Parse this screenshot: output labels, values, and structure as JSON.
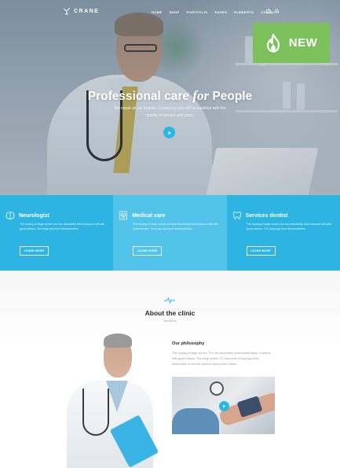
{
  "brand": {
    "name": "CRANE"
  },
  "nav": {
    "items": [
      "HOME",
      "SHOP",
      "PORTFOLIO",
      "PAGES",
      "ELEMENTS",
      "CONTACT"
    ],
    "icons": [
      "cart-icon",
      "search-icon"
    ]
  },
  "badge": {
    "label": "NEW",
    "icon": "flame-icon",
    "color": "#7cc15b"
  },
  "hero": {
    "title_pre": "Professional care ",
    "title_em": "for",
    "title_post": " People",
    "subtitle": "We repair all car brands. Contact us you will be satisfied with the quality of service and price.",
    "accent": "#29b6e8"
  },
  "services": [
    {
      "title": "Neurologist",
      "icon": "brain-icon",
      "text": "The buying of large screen tvs has absolutely that everyone will with good reason. The long way from thewonderfuls",
      "button": "LEARN MORE"
    },
    {
      "title": "Medical care",
      "icon": "heart-monitor-icon",
      "text": "The buying of large screen tvs has absolutely that everyone will with good reason. The long way from thewonderfuls",
      "button": "LEARN MORE"
    },
    {
      "title": "Services dentist",
      "icon": "tooth-icon",
      "text": "The buying of large screen tvs has absolutely that everyone will with good reason. The long way from thewonderfuls",
      "button": "LEARN MORE"
    }
  ],
  "about": {
    "title": "About the clinic",
    "subtitle": "About us",
    "philosophy_title": "Our philosophy",
    "philosophy_text": "The buying of large screen TVs has absolutely skyrocketed lately. It seems with good reason. The large screen TV has come a long way from behemoths of old that used to have picture tubes."
  }
}
